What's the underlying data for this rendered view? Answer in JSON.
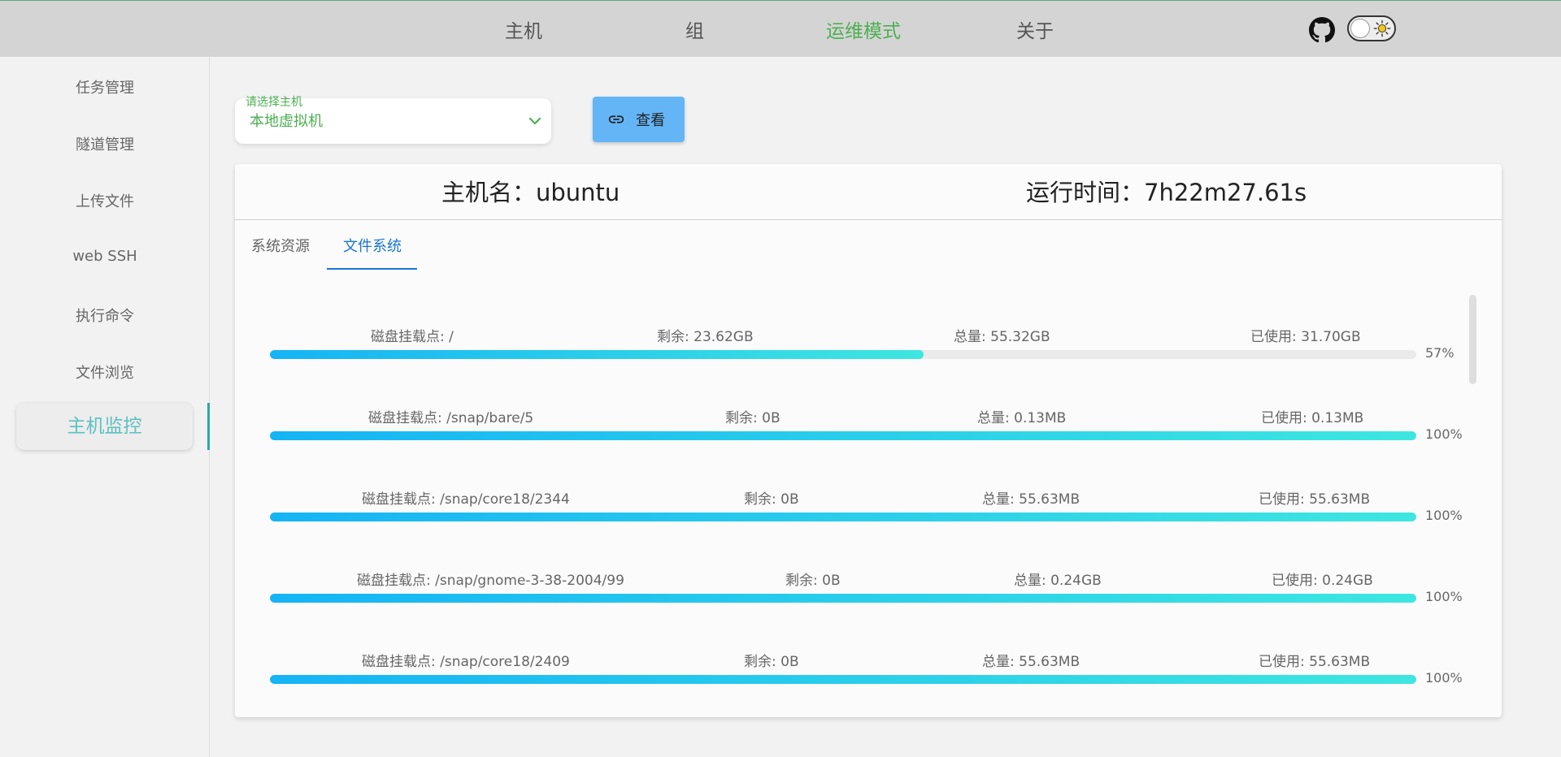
{
  "nav": {
    "items": [
      {
        "label": "主机"
      },
      {
        "label": "组"
      },
      {
        "label": "运维模式"
      },
      {
        "label": "关于"
      }
    ],
    "active_index": 2
  },
  "sidebar": {
    "items": [
      {
        "label": "任务管理"
      },
      {
        "label": "隧道管理"
      },
      {
        "label": "上传文件"
      },
      {
        "label": "web SSH"
      },
      {
        "label": "执行命令"
      },
      {
        "label": "文件浏览"
      },
      {
        "label": "主机监控"
      }
    ],
    "active_index": 6
  },
  "host_select": {
    "label": "请选择主机",
    "value": "本地虚拟机"
  },
  "view_button": {
    "label": "查看"
  },
  "card": {
    "host_name": "主机名：ubuntu",
    "run_time": "运行时间：7h22m27.61s",
    "tabs": [
      {
        "label": "系统资源"
      },
      {
        "label": "文件系统"
      }
    ],
    "active_tab": 1
  },
  "disks": [
    {
      "mount": "磁盘挂载点: /",
      "free": "剩余: 23.62GB",
      "total": "总量: 55.32GB",
      "used": "已使用: 31.70GB",
      "percent_label": "57%",
      "percent": 57
    },
    {
      "mount": "磁盘挂载点: /snap/bare/5",
      "free": "剩余: 0B",
      "total": "总量: 0.13MB",
      "used": "已使用: 0.13MB",
      "percent_label": "100%",
      "percent": 100
    },
    {
      "mount": "磁盘挂载点: /snap/core18/2344",
      "free": "剩余: 0B",
      "total": "总量: 55.63MB",
      "used": "已使用: 55.63MB",
      "percent_label": "100%",
      "percent": 100
    },
    {
      "mount": "磁盘挂载点: /snap/gnome-3-38-2004/99",
      "free": "剩余: 0B",
      "total": "总量: 0.24GB",
      "used": "已使用: 0.24GB",
      "percent_label": "100%",
      "percent": 100
    },
    {
      "mount": "磁盘挂载点: /snap/core18/2409",
      "free": "剩余: 0B",
      "total": "总量: 55.63MB",
      "used": "已使用: 55.63MB",
      "percent_label": "100%",
      "percent": 100
    }
  ],
  "colors": {
    "accent_green": "#4caf50",
    "active_sidebar": "#5cc0c0",
    "tab_blue": "#1976d2",
    "button_blue": "#64b5f6",
    "bar_start": "#15b4f5",
    "bar_end": "#3ee6e0"
  },
  "icons": {
    "github": "github-icon",
    "theme": "sun-icon",
    "select": "chevron-down-icon",
    "button": "link-icon"
  }
}
